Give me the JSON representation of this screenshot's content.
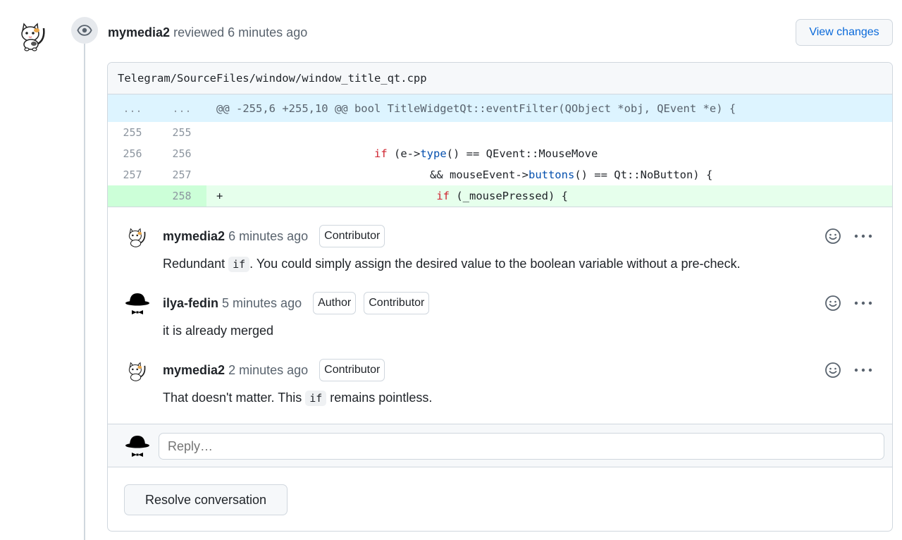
{
  "review": {
    "reviewer": "mymedia2",
    "action": "reviewed",
    "time": "6 minutes ago",
    "view_changes_label": "View changes"
  },
  "file": {
    "path": "Telegram/SourceFiles/window/window_title_qt.cpp"
  },
  "diff": {
    "hunk": {
      "old": "...",
      "new": "...",
      "text": "@@ -255,6 +255,10 @@ bool TitleWidgetQt::eventFilter(QObject *obj, QEvent *e) {"
    },
    "lines": [
      {
        "old": "255",
        "new": "255",
        "type": "context"
      },
      {
        "old": "256",
        "new": "256",
        "type": "context"
      },
      {
        "old": "257",
        "new": "257",
        "type": "context"
      },
      {
        "old": "",
        "new": "258",
        "type": "add",
        "marker": "+"
      }
    ],
    "code": {
      "l256_kw": "if",
      "l256_a": " (e->",
      "l256_fn": "type",
      "l256_b": "() == QEvent::MouseMove",
      "l257_a": "&& mouseEvent->",
      "l257_fn": "buttons",
      "l257_b": "() == Qt::NoButton) {",
      "l258_kw": "if",
      "l258_a": " (_mousePressed) {"
    }
  },
  "comments": [
    {
      "author": "mymedia2",
      "time": "6 minutes ago",
      "badges": [
        "Contributor"
      ],
      "body_a": "Redundant ",
      "body_code": "if",
      "body_b": ". You could simply assign the desired value to the boolean variable without a pre-check."
    },
    {
      "author": "ilya-fedin",
      "time": "5 minutes ago",
      "badges": [
        "Author",
        "Contributor"
      ],
      "body_a": "it is already merged"
    },
    {
      "author": "mymedia2",
      "time": "2 minutes ago",
      "badges": [
        "Contributor"
      ],
      "body_a": "That doesn't matter. This ",
      "body_code": "if",
      "body_b": " remains pointless."
    }
  ],
  "reply": {
    "placeholder": "Reply…"
  },
  "resolve_label": "Resolve conversation",
  "icons": {
    "eye": "eye-icon",
    "smiley": "smiley-icon",
    "more": "kebab-horizontal-icon",
    "cat_avatar": "cat-avatar",
    "hat_avatar": "bowler-hat-avatar"
  },
  "colors": {
    "link": "#0969da",
    "hunk_bg": "#ddf4ff",
    "add_bg": "#e6ffec",
    "keyword": "#cf222e",
    "function": "#0550ae"
  }
}
